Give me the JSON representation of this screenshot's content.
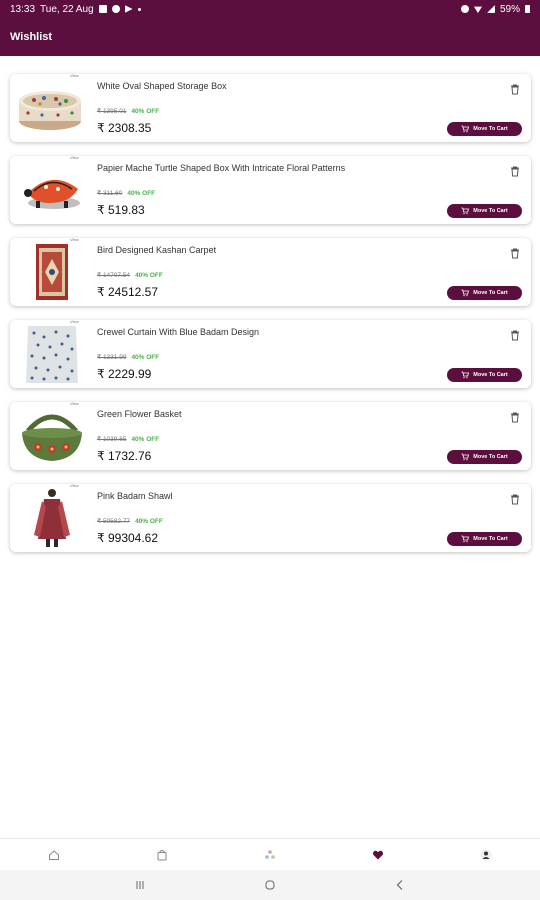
{
  "status_bar": {
    "time": "13:33",
    "date": "Tue, 22 Aug",
    "battery": "59%"
  },
  "app_bar": {
    "title": "Wishlist"
  },
  "items": [
    {
      "title": "White Oval Shaped Storage Box",
      "mrp": "₹ 1395.01",
      "off": "40% OFF",
      "price": "₹ 2308.35",
      "view_tag": "View",
      "button": "Move To Cart"
    },
    {
      "title": "Papier Mache Turtle Shaped Box With Intricate Floral Patterns",
      "mrp": "₹ 311.60",
      "off": "40% OFF",
      "price": "₹ 519.83",
      "view_tag": "View",
      "button": "Move To Cart"
    },
    {
      "title": "Bird Designed Kashan Carpet",
      "mrp": "₹ 14707.54",
      "off": "40% OFF",
      "price": "₹ 24512.57",
      "view_tag": "View",
      "button": "Move To Cart"
    },
    {
      "title": "Crewel Curtain With Blue Badam Design",
      "mrp": "₹ 1331.99",
      "off": "40% OFF",
      "price": "₹ 2229.99",
      "view_tag": "View",
      "button": "Move To Cart"
    },
    {
      "title": "Green Flower Basket",
      "mrp": "₹ 1039.65",
      "off": "40% OFF",
      "price": "₹ 1732.76",
      "view_tag": "View",
      "button": "Move To Cart"
    },
    {
      "title": "Pink Badam Shawl",
      "mrp": "₹ 59582.77",
      "off": "40% OFF",
      "price": "₹ 99304.62",
      "view_tag": "View",
      "button": "Move To Cart"
    }
  ],
  "bottom_nav": {
    "items": [
      "home-icon",
      "bag-icon",
      "category-icon",
      "heart-icon",
      "profile-icon"
    ],
    "active_color": "#5c0f3e",
    "inactive_color": "#888888"
  },
  "colors": {
    "brand": "#5c0f3e",
    "discount": "#4caf50"
  }
}
